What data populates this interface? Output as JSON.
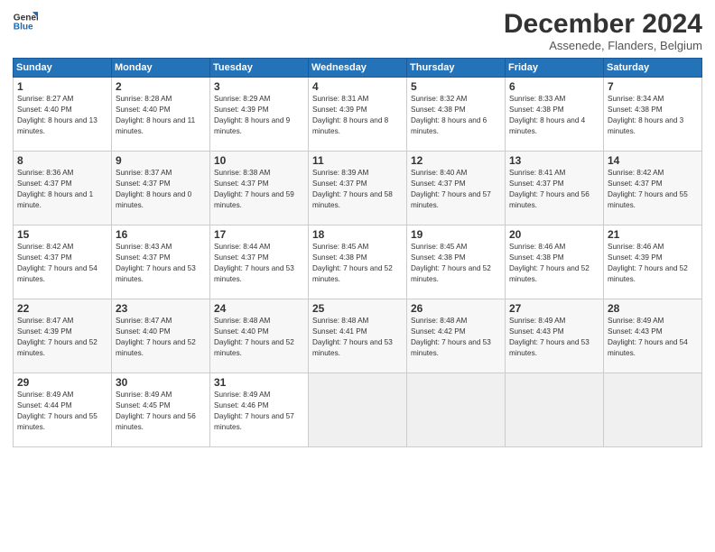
{
  "logo": {
    "line1": "General",
    "line2": "Blue"
  },
  "title": "December 2024",
  "subtitle": "Assenede, Flanders, Belgium",
  "days_of_week": [
    "Sunday",
    "Monday",
    "Tuesday",
    "Wednesday",
    "Thursday",
    "Friday",
    "Saturday"
  ],
  "weeks": [
    [
      {
        "num": "1",
        "sunrise": "8:27 AM",
        "sunset": "4:40 PM",
        "daylight": "8 hours and 13 minutes."
      },
      {
        "num": "2",
        "sunrise": "8:28 AM",
        "sunset": "4:40 PM",
        "daylight": "8 hours and 11 minutes."
      },
      {
        "num": "3",
        "sunrise": "8:29 AM",
        "sunset": "4:39 PM",
        "daylight": "8 hours and 9 minutes."
      },
      {
        "num": "4",
        "sunrise": "8:31 AM",
        "sunset": "4:39 PM",
        "daylight": "8 hours and 8 minutes."
      },
      {
        "num": "5",
        "sunrise": "8:32 AM",
        "sunset": "4:38 PM",
        "daylight": "8 hours and 6 minutes."
      },
      {
        "num": "6",
        "sunrise": "8:33 AM",
        "sunset": "4:38 PM",
        "daylight": "8 hours and 4 minutes."
      },
      {
        "num": "7",
        "sunrise": "8:34 AM",
        "sunset": "4:38 PM",
        "daylight": "8 hours and 3 minutes."
      }
    ],
    [
      {
        "num": "8",
        "sunrise": "8:36 AM",
        "sunset": "4:37 PM",
        "daylight": "8 hours and 1 minute."
      },
      {
        "num": "9",
        "sunrise": "8:37 AM",
        "sunset": "4:37 PM",
        "daylight": "8 hours and 0 minutes."
      },
      {
        "num": "10",
        "sunrise": "8:38 AM",
        "sunset": "4:37 PM",
        "daylight": "7 hours and 59 minutes."
      },
      {
        "num": "11",
        "sunrise": "8:39 AM",
        "sunset": "4:37 PM",
        "daylight": "7 hours and 58 minutes."
      },
      {
        "num": "12",
        "sunrise": "8:40 AM",
        "sunset": "4:37 PM",
        "daylight": "7 hours and 57 minutes."
      },
      {
        "num": "13",
        "sunrise": "8:41 AM",
        "sunset": "4:37 PM",
        "daylight": "7 hours and 56 minutes."
      },
      {
        "num": "14",
        "sunrise": "8:42 AM",
        "sunset": "4:37 PM",
        "daylight": "7 hours and 55 minutes."
      }
    ],
    [
      {
        "num": "15",
        "sunrise": "8:42 AM",
        "sunset": "4:37 PM",
        "daylight": "7 hours and 54 minutes."
      },
      {
        "num": "16",
        "sunrise": "8:43 AM",
        "sunset": "4:37 PM",
        "daylight": "7 hours and 53 minutes."
      },
      {
        "num": "17",
        "sunrise": "8:44 AM",
        "sunset": "4:37 PM",
        "daylight": "7 hours and 53 minutes."
      },
      {
        "num": "18",
        "sunrise": "8:45 AM",
        "sunset": "4:38 PM",
        "daylight": "7 hours and 52 minutes."
      },
      {
        "num": "19",
        "sunrise": "8:45 AM",
        "sunset": "4:38 PM",
        "daylight": "7 hours and 52 minutes."
      },
      {
        "num": "20",
        "sunrise": "8:46 AM",
        "sunset": "4:38 PM",
        "daylight": "7 hours and 52 minutes."
      },
      {
        "num": "21",
        "sunrise": "8:46 AM",
        "sunset": "4:39 PM",
        "daylight": "7 hours and 52 minutes."
      }
    ],
    [
      {
        "num": "22",
        "sunrise": "8:47 AM",
        "sunset": "4:39 PM",
        "daylight": "7 hours and 52 minutes."
      },
      {
        "num": "23",
        "sunrise": "8:47 AM",
        "sunset": "4:40 PM",
        "daylight": "7 hours and 52 minutes."
      },
      {
        "num": "24",
        "sunrise": "8:48 AM",
        "sunset": "4:40 PM",
        "daylight": "7 hours and 52 minutes."
      },
      {
        "num": "25",
        "sunrise": "8:48 AM",
        "sunset": "4:41 PM",
        "daylight": "7 hours and 53 minutes."
      },
      {
        "num": "26",
        "sunrise": "8:48 AM",
        "sunset": "4:42 PM",
        "daylight": "7 hours and 53 minutes."
      },
      {
        "num": "27",
        "sunrise": "8:49 AM",
        "sunset": "4:43 PM",
        "daylight": "7 hours and 53 minutes."
      },
      {
        "num": "28",
        "sunrise": "8:49 AM",
        "sunset": "4:43 PM",
        "daylight": "7 hours and 54 minutes."
      }
    ],
    [
      {
        "num": "29",
        "sunrise": "8:49 AM",
        "sunset": "4:44 PM",
        "daylight": "7 hours and 55 minutes."
      },
      {
        "num": "30",
        "sunrise": "8:49 AM",
        "sunset": "4:45 PM",
        "daylight": "7 hours and 56 minutes."
      },
      {
        "num": "31",
        "sunrise": "8:49 AM",
        "sunset": "4:46 PM",
        "daylight": "7 hours and 57 minutes."
      },
      null,
      null,
      null,
      null
    ]
  ]
}
